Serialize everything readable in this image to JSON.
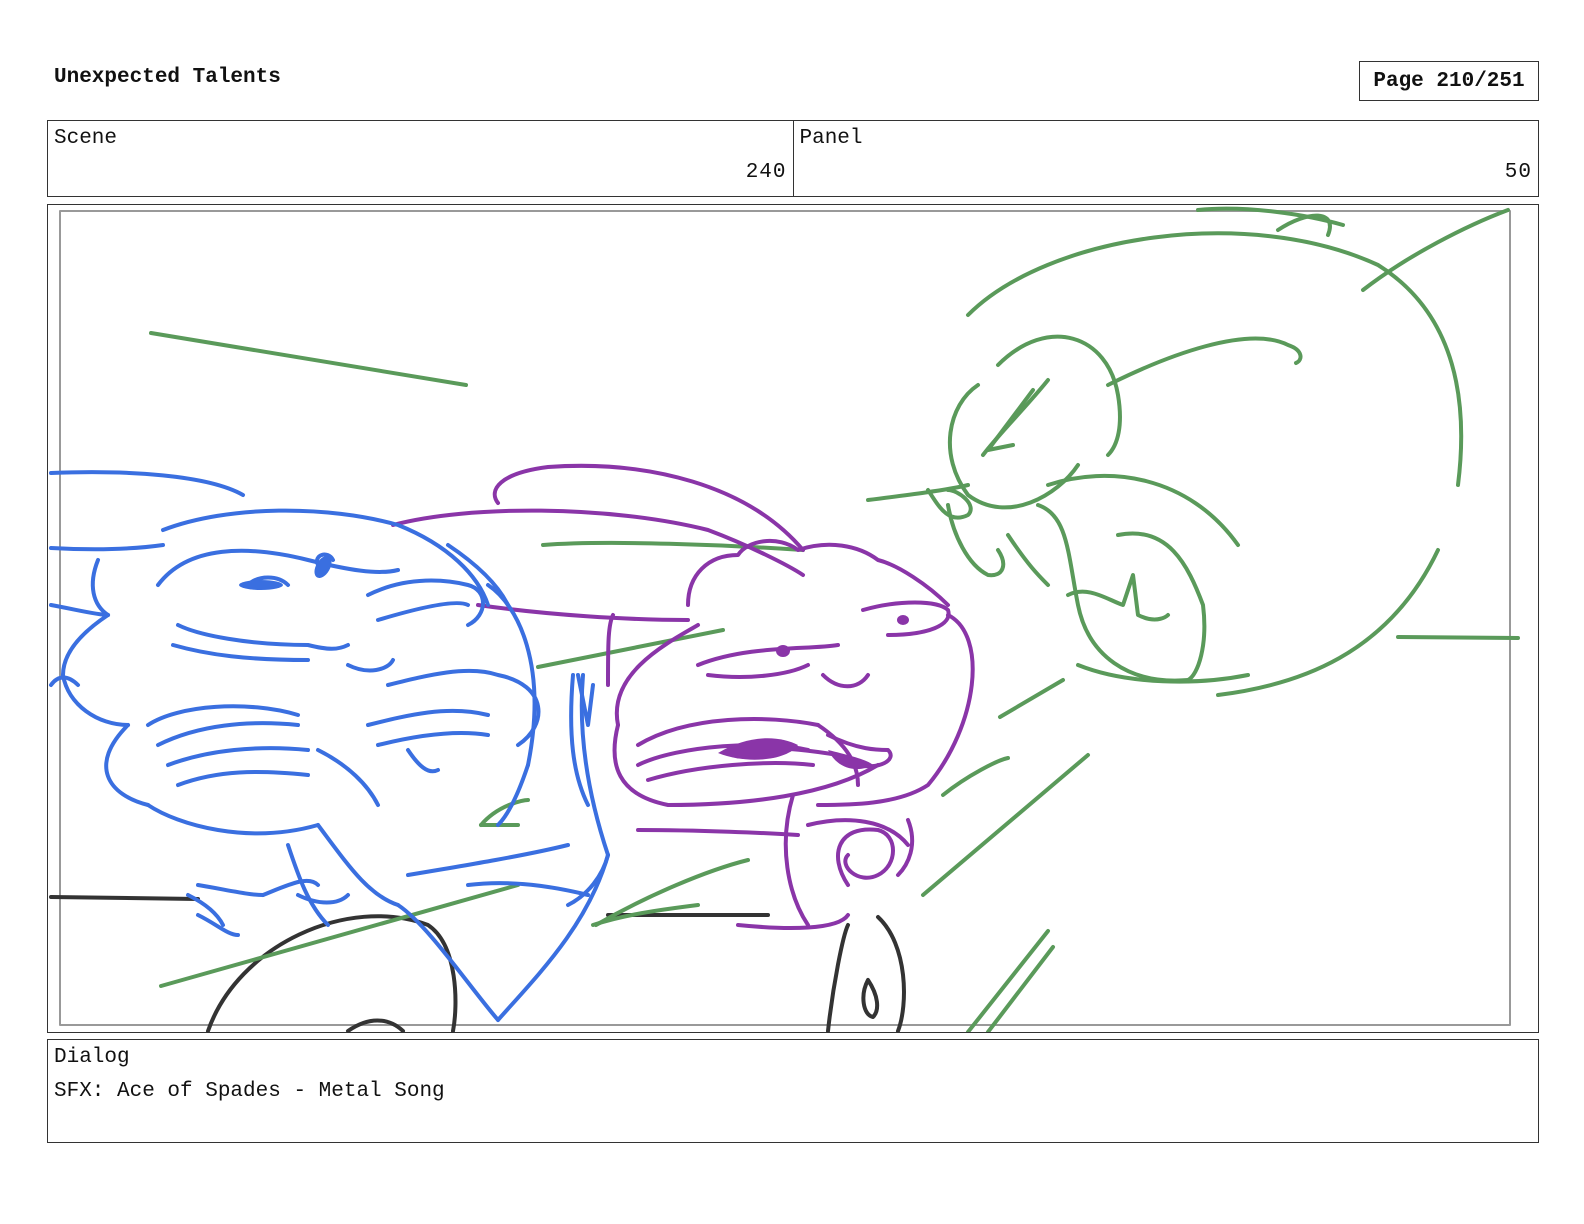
{
  "header": {
    "title": "Unexpected Talents",
    "page_indicator": "Page 210/251"
  },
  "info": {
    "scene_label": "Scene",
    "scene_value": "240",
    "panel_label": "Panel",
    "panel_value": "50"
  },
  "dialog": {
    "label": "Dialog",
    "text": "SFX: Ace of Spades - Metal Song"
  },
  "sketch_colors": {
    "character_left": "#3a6fe0",
    "character_middle": "#8a35a8",
    "character_right": "#5a9a5a",
    "props": "#333333"
  }
}
